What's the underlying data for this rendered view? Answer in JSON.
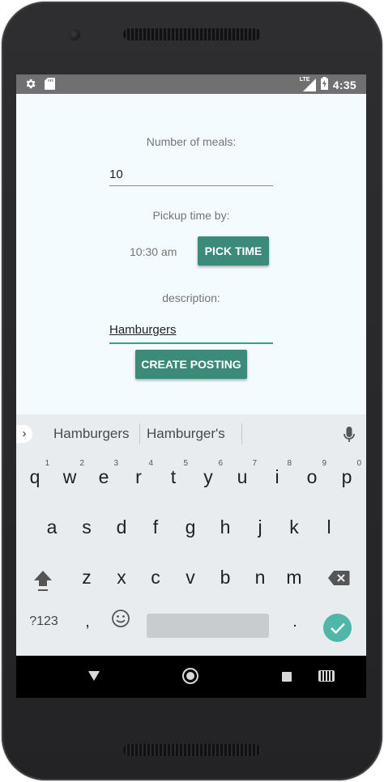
{
  "status_bar": {
    "left_icons": [
      "gear-icon",
      "sd-card-icon"
    ],
    "network_label": "LTE",
    "time": "4:35"
  },
  "form": {
    "meals_label": "Number of meals:",
    "meals_value": "10",
    "pickup_label": "Pickup time by:",
    "pickup_time": "10:30 am",
    "pick_time_button": "PICK TIME",
    "description_label": "description:",
    "description_value": "Hamburgers",
    "create_button": "CREATE POSTING"
  },
  "keyboard": {
    "suggestions": [
      "Hamburgers",
      "Hamburger's"
    ],
    "row1": [
      {
        "key": "q",
        "hint": "1"
      },
      {
        "key": "w",
        "hint": "2"
      },
      {
        "key": "e",
        "hint": "3"
      },
      {
        "key": "r",
        "hint": "4"
      },
      {
        "key": "t",
        "hint": "5"
      },
      {
        "key": "y",
        "hint": "6"
      },
      {
        "key": "u",
        "hint": "7"
      },
      {
        "key": "i",
        "hint": "8"
      },
      {
        "key": "o",
        "hint": "9"
      },
      {
        "key": "p",
        "hint": "0"
      }
    ],
    "row2": [
      "a",
      "s",
      "d",
      "f",
      "g",
      "h",
      "j",
      "k",
      "l"
    ],
    "row3": [
      "z",
      "x",
      "c",
      "v",
      "b",
      "n",
      "m"
    ],
    "symbols_key": "?123",
    "comma_key": ",",
    "period_key": "."
  },
  "colors": {
    "accent": "#3b8a7a",
    "enter_key": "#4fb6a8",
    "screen_bg": "#f4fbfe",
    "status_bar": "#707070"
  }
}
